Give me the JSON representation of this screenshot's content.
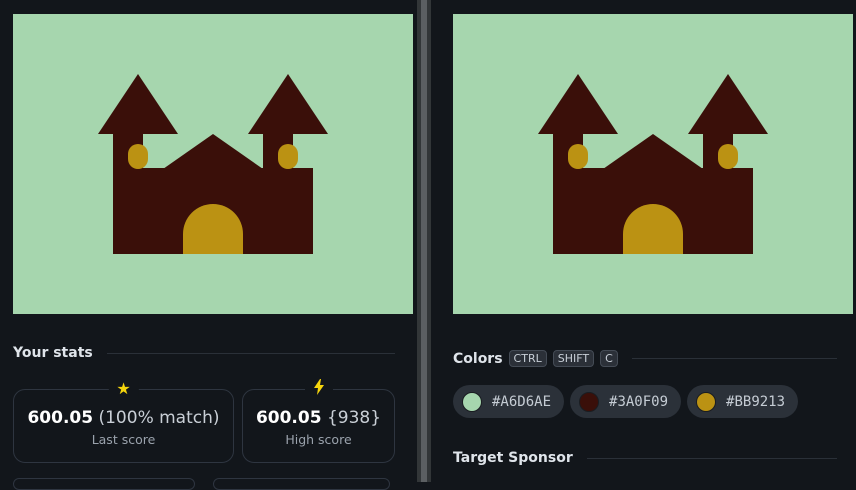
{
  "left": {
    "stats_title": "Your stats",
    "last_score": {
      "value": "600.05",
      "extra": "(100% match)",
      "label": "Last score",
      "icon": "star-icon"
    },
    "high_score": {
      "value": "600.05",
      "extra": "{938}",
      "label": "High score",
      "icon": "lightning-icon"
    }
  },
  "right": {
    "colors_title": "Colors",
    "shortcut": [
      "CTRL",
      "SHIFT",
      "C"
    ],
    "swatches": [
      {
        "hex": "#A6D6AE",
        "color": "#a6d6ae"
      },
      {
        "hex": "#3A0F09",
        "color": "#3a0f09"
      },
      {
        "hex": "#BB9213",
        "color": "#bb9213"
      }
    ],
    "sponsor_title": "Target Sponsor"
  },
  "palette": {
    "background": "#a6d6ae",
    "castle": "#3a0f09",
    "accent": "#bb9213"
  }
}
